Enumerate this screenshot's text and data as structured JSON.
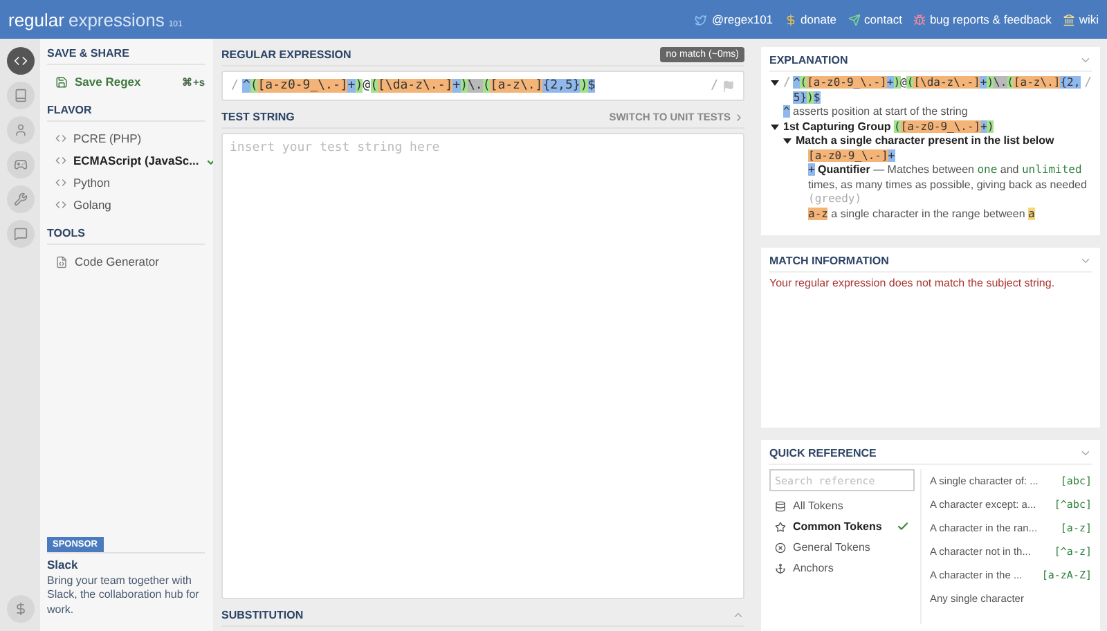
{
  "topbar": {
    "logo_main": "regular",
    "logo_sub": "expressions",
    "logo_version": "101",
    "links": [
      {
        "kind": "twitter",
        "label": "@regex101"
      },
      {
        "kind": "dollar",
        "label": "donate"
      },
      {
        "kind": "send",
        "label": "contact"
      },
      {
        "kind": "bug",
        "label": "bug reports & feedback"
      },
      {
        "kind": "library",
        "label": "wiki"
      }
    ]
  },
  "nav_rail": {
    "items": [
      {
        "kind": "code",
        "selected": true
      },
      {
        "kind": "book",
        "selected": false
      },
      {
        "kind": "user",
        "selected": false
      },
      {
        "kind": "gamepad",
        "selected": false
      },
      {
        "kind": "wrench",
        "selected": false
      },
      {
        "kind": "chat",
        "selected": false
      }
    ]
  },
  "sidebar": {
    "save_share": {
      "title": "SAVE & SHARE",
      "button": "Save Regex",
      "shortcut": "⌘+s"
    },
    "flavor": {
      "title": "FLAVOR",
      "items": [
        {
          "label": "PCRE (PHP)",
          "selected": false
        },
        {
          "label": "ECMAScript (JavaSc...",
          "selected": true
        },
        {
          "label": "Python",
          "selected": false
        },
        {
          "label": "Golang",
          "selected": false
        }
      ]
    },
    "tools": {
      "title": "TOOLS",
      "items": [
        "Code Generator"
      ]
    },
    "sponsor": {
      "badge": "SPONSOR",
      "name": "Slack",
      "text": "Bring your team together with Slack, the collaboration hub for work."
    }
  },
  "regex_editor": {
    "title": "REGULAR EXPRESSION",
    "status": "no match (~0ms)",
    "delimiter_open": "/",
    "delimiter_close": "/",
    "tokens": [
      {
        "text": "^",
        "kind": "anchor"
      },
      {
        "text": "(",
        "kind": "group"
      },
      {
        "text": "[a-z0-9_\\.-]",
        "kind": "class"
      },
      {
        "text": "+",
        "kind": "quant"
      },
      {
        "text": ")",
        "kind": "group"
      },
      {
        "text": "@",
        "kind": "literal"
      },
      {
        "text": "(",
        "kind": "group"
      },
      {
        "text": "[\\da-z\\.-]",
        "kind": "class"
      },
      {
        "text": "+",
        "kind": "quant"
      },
      {
        "text": ")",
        "kind": "group"
      },
      {
        "text": "\\.",
        "kind": "escape"
      },
      {
        "text": "(",
        "kind": "group"
      },
      {
        "text": "[a-z\\.]",
        "kind": "class"
      },
      {
        "text": "{2,5}",
        "kind": "quant"
      },
      {
        "text": ")",
        "kind": "group"
      },
      {
        "text": "$",
        "kind": "anchor"
      }
    ]
  },
  "test_string": {
    "title": "TEST STRING",
    "switch_link": "SWITCH TO UNIT TESTS",
    "placeholder": "insert your test string here"
  },
  "substitution": {
    "title": "SUBSTITUTION"
  },
  "explanation": {
    "title": "EXPLANATION",
    "root": {
      "expanded": true,
      "delimiter_open": "/",
      "delimiter_close": "/",
      "tokens": [
        {
          "text": "^",
          "kind": "anchor"
        },
        {
          "text": "(",
          "kind": "group"
        },
        {
          "text": "[a-z0-9_\\.-]",
          "kind": "class"
        },
        {
          "text": "+",
          "kind": "quant"
        },
        {
          "text": ")",
          "kind": "group"
        },
        {
          "text": "@",
          "kind": "literal"
        },
        {
          "text": "(",
          "kind": "group"
        },
        {
          "text": "[\\da-z\\.-]",
          "kind": "class"
        },
        {
          "text": "+",
          "kind": "quant"
        },
        {
          "text": ")",
          "kind": "group"
        },
        {
          "text": "\\.",
          "kind": "escape"
        },
        {
          "text": "(",
          "kind": "group"
        },
        {
          "text": "[a-z\\.]",
          "kind": "class"
        },
        {
          "text": "{2,5}",
          "kind": "quant"
        },
        {
          "text": ")",
          "kind": "group"
        },
        {
          "text": "$",
          "kind": "anchor"
        }
      ],
      "children": [
        {
          "segments": [
            {
              "text": "^",
              "kind": "anchor"
            },
            {
              "text": " asserts position at start of the string",
              "kind": "text"
            }
          ]
        },
        {
          "expanded": true,
          "segments": [
            {
              "text": "1st Capturing Group ",
              "kind": "bold"
            },
            {
              "text": "(",
              "kind": "group"
            },
            {
              "text": "[a-z0-9_\\.-]",
              "kind": "class"
            },
            {
              "text": "+",
              "kind": "quant"
            },
            {
              "text": ")",
              "kind": "group"
            }
          ],
          "children": [
            {
              "expanded": true,
              "segments": [
                {
                  "text": "Match a single character present in the list below",
                  "kind": "bold"
                }
              ],
              "children": [
                {
                  "segments": [
                    {
                      "text": "[a-z0-9_\\.-]",
                      "kind": "class"
                    },
                    {
                      "text": "+",
                      "kind": "quant"
                    }
                  ]
                },
                {
                  "segments": [
                    {
                      "text": "+",
                      "kind": "quant"
                    },
                    {
                      "text": " Quantifier",
                      "kind": "bold"
                    },
                    {
                      "text": " — Matches between ",
                      "kind": "text"
                    },
                    {
                      "text": "one",
                      "kind": "code"
                    },
                    {
                      "text": " and ",
                      "kind": "text"
                    },
                    {
                      "text": "unlimited",
                      "kind": "code"
                    },
                    {
                      "text": " times, as many times as possible, giving back as needed ",
                      "kind": "text"
                    },
                    {
                      "text": "(greedy)",
                      "kind": "muted"
                    }
                  ]
                },
                {
                  "segments": [
                    {
                      "text": "a-z",
                      "kind": "class"
                    },
                    {
                      "text": " a single character in the range between ",
                      "kind": "text"
                    },
                    {
                      "text": "a",
                      "kind": "char"
                    }
                  ]
                }
              ]
            }
          ]
        }
      ]
    }
  },
  "match_information": {
    "title": "MATCH INFORMATION",
    "message": "Your regular expression does not match the subject string."
  },
  "quick_reference": {
    "title": "QUICK REFERENCE",
    "search_placeholder": "Search reference",
    "categories": [
      {
        "kind": "database",
        "label": "All Tokens",
        "selected": false
      },
      {
        "kind": "star",
        "label": "Common Tokens",
        "selected": true
      },
      {
        "kind": "circle-x",
        "label": "General Tokens",
        "selected": false
      },
      {
        "kind": "anchor",
        "label": "Anchors",
        "selected": false
      }
    ],
    "tokens": [
      {
        "description": "A single character of: ...",
        "token": "[abc]"
      },
      {
        "description": "A character except: a...",
        "token": "[^abc]"
      },
      {
        "description": "A character in the ran...",
        "token": "[a-z]"
      },
      {
        "description": "A character not in th...",
        "token": "[^a-z]"
      },
      {
        "description": "A character in the ...",
        "token": "[a-zA-Z]"
      },
      {
        "description": "Any single character"
      }
    ]
  }
}
